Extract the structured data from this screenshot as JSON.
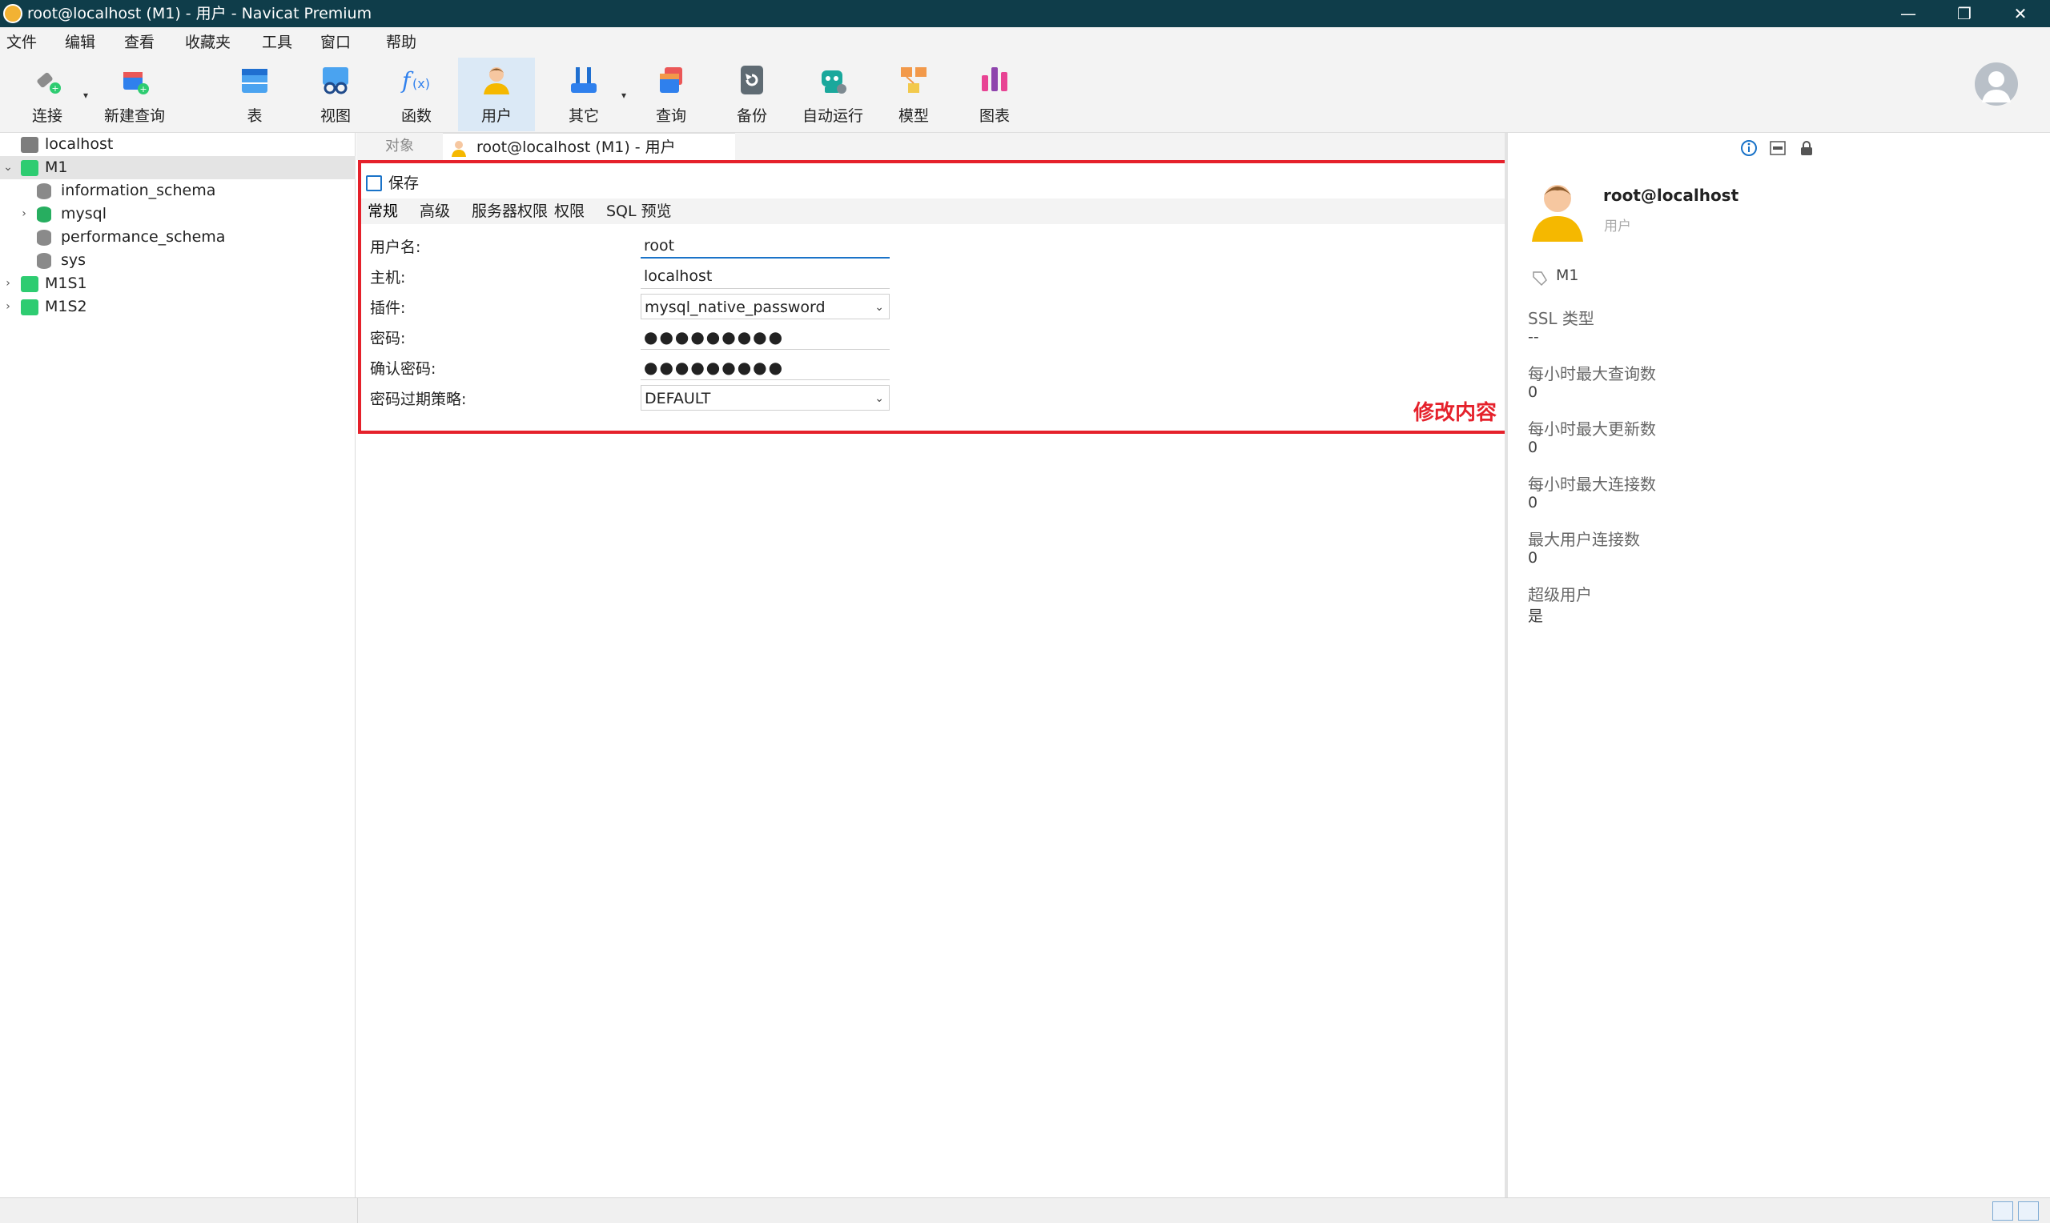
{
  "window": {
    "title": "root@localhost (M1) - 用户 - Navicat Premium"
  },
  "menu": [
    "文件",
    "编辑",
    "查看",
    "收藏夹",
    "工具",
    "窗口",
    "帮助"
  ],
  "toolbar": {
    "items": [
      {
        "label": "连接",
        "icon": "plug-icon"
      },
      {
        "label": "新建查询",
        "icon": "new-query-icon"
      },
      {
        "label": "表",
        "icon": "table-icon"
      },
      {
        "label": "视图",
        "icon": "view-icon"
      },
      {
        "label": "函数",
        "icon": "function-icon"
      },
      {
        "label": "用户",
        "icon": "user-icon"
      },
      {
        "label": "其它",
        "icon": "tools-icon"
      },
      {
        "label": "查询",
        "icon": "query-icon"
      },
      {
        "label": "备份",
        "icon": "backup-icon"
      },
      {
        "label": "自动运行",
        "icon": "robot-icon"
      },
      {
        "label": "模型",
        "icon": "model-icon"
      },
      {
        "label": "图表",
        "icon": "chart-icon"
      }
    ]
  },
  "tree": {
    "items": [
      {
        "label": "localhost"
      },
      {
        "label": "M1"
      },
      {
        "label": "information_schema"
      },
      {
        "label": "mysql"
      },
      {
        "label": "performance_schema"
      },
      {
        "label": "sys"
      },
      {
        "label": "M1S1"
      },
      {
        "label": "M1S2"
      }
    ]
  },
  "tabs": {
    "objects": "对象",
    "active": "root@localhost (M1) - 用户"
  },
  "editor": {
    "save_label": "保存",
    "subtabs": [
      "常规",
      "高级",
      "服务器权限",
      "权限",
      "SQL 预览"
    ],
    "fields": [
      {
        "label": "用户名:",
        "value": "root"
      },
      {
        "label": "主机:",
        "value": "localhost"
      },
      {
        "label": "插件:",
        "value": "mysql_native_password"
      },
      {
        "label": "密码:",
        "value": "●●●●●●●●●"
      },
      {
        "label": "确认密码:",
        "value": "●●●●●●●●●"
      },
      {
        "label": "密码过期策略:",
        "value": "DEFAULT"
      }
    ],
    "annotation": "修改内容"
  },
  "info": {
    "name": "root@localhost",
    "subtitle": "用户",
    "connection": "M1",
    "props": [
      {
        "key": "SSL 类型",
        "value": "--"
      },
      {
        "key": "每小时最大查询数",
        "value": "0"
      },
      {
        "key": "每小时最大更新数",
        "value": "0"
      },
      {
        "key": "每小时最大连接数",
        "value": "0"
      },
      {
        "key": "最大用户连接数",
        "value": "0"
      },
      {
        "key": "超级用户",
        "value": "是"
      }
    ]
  },
  "colors": {
    "titlebar": "#0f3d4a",
    "accent": "#1a73c8",
    "highlight_box": "#e5212b"
  }
}
